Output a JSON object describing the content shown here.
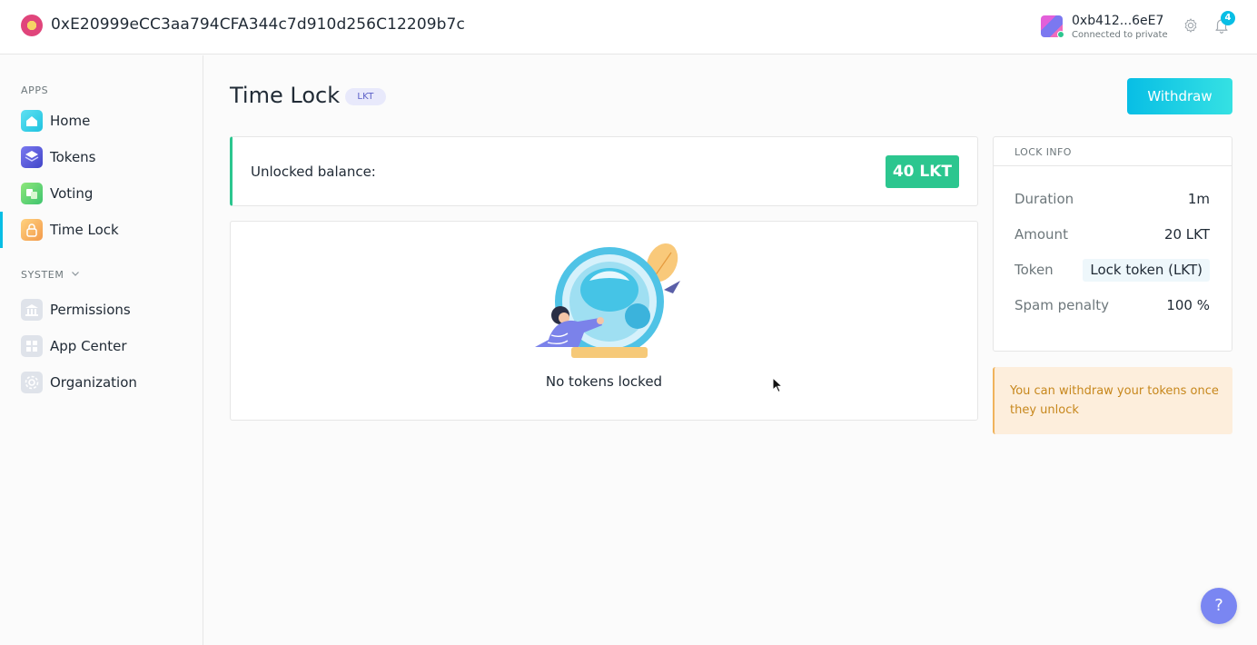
{
  "header": {
    "org_address": "0xE20999eCC3aa794CFA344c7d910d256C12209b7c",
    "account_address": "0xb412...6eE7",
    "account_status": "Connected to private",
    "notification_count": "4"
  },
  "sidebar": {
    "apps_label": "APPS",
    "system_label": "SYSTEM",
    "apps": [
      {
        "label": "Home",
        "icon": "home-icon"
      },
      {
        "label": "Tokens",
        "icon": "tokens-icon"
      },
      {
        "label": "Voting",
        "icon": "voting-icon"
      },
      {
        "label": "Time Lock",
        "icon": "time-lock-icon"
      }
    ],
    "system": [
      {
        "label": "Permissions",
        "icon": "permissions-icon"
      },
      {
        "label": "App Center",
        "icon": "app-center-icon"
      },
      {
        "label": "Organization",
        "icon": "organization-icon"
      }
    ]
  },
  "main": {
    "title": "Time Lock",
    "token_badge": "LKT",
    "withdraw_label": "Withdraw",
    "balance_label": "Unlocked balance:",
    "balance_value": "40 LKT",
    "empty_text": "No tokens locked"
  },
  "lock_info": {
    "title": "LOCK INFO",
    "rows": [
      {
        "key": "Duration",
        "value": "1m"
      },
      {
        "key": "Amount",
        "value": "20 LKT"
      },
      {
        "key": "Token",
        "value": "Lock token (LKT)"
      },
      {
        "key": "Spam penalty",
        "value": "100 %"
      }
    ]
  },
  "notice": {
    "text": "You can withdraw your tokens once they unlock"
  },
  "help": {
    "label": "?"
  },
  "colors": {
    "accent": "#08bee5",
    "positive": "#2cc68f",
    "warning_bg": "#fdeedc",
    "warning_text": "#c7871c"
  }
}
